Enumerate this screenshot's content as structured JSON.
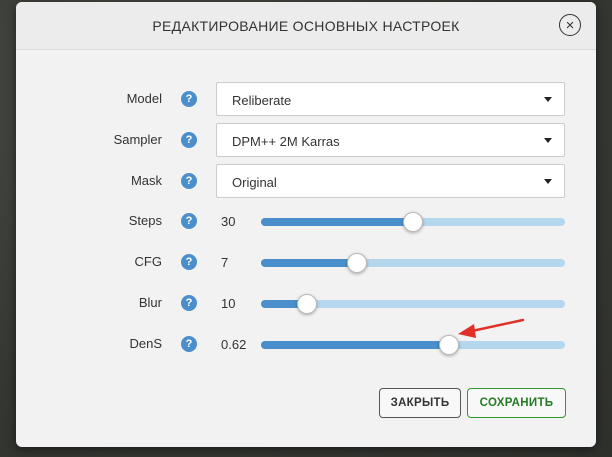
{
  "dialog": {
    "title": "РЕДАКТИРОВАНИЕ ОСНОВНЫХ НАСТРОЕК",
    "close_symbol": "×"
  },
  "help_symbol": "?",
  "fields": {
    "model": {
      "label": "Model",
      "value": "Reliberate"
    },
    "sampler": {
      "label": "Sampler",
      "value": "DPM++ 2M Karras"
    },
    "mask": {
      "label": "Mask",
      "value": "Original"
    }
  },
  "sliders": [
    {
      "label": "Steps",
      "value": "30",
      "fill": 0.5
    },
    {
      "label": "CFG",
      "value": "7",
      "fill": 0.315
    },
    {
      "label": "Blur",
      "value": "10",
      "fill": 0.15
    },
    {
      "label": "DenS",
      "value": "0.62",
      "fill": 0.62
    }
  ],
  "buttons": {
    "close_label": "ЗАКРЫТЬ",
    "save_label": "СОХРАНИТЬ"
  },
  "colors": {
    "accent": "#4a8ecb",
    "track": "#b5d7ee",
    "save": "#2e9a2e",
    "annotation_arrow": "#e0302a"
  },
  "icons": [
    "close-icon",
    "help-icon",
    "chevron-down-icon",
    "red-arrow-annotation"
  ]
}
